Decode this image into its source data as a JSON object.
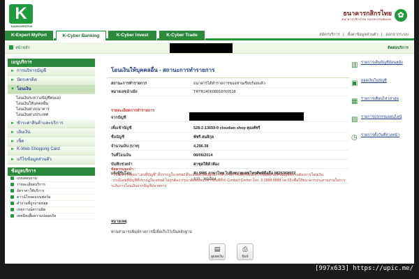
{
  "header": {
    "logo_letter": "K",
    "logo_text": "KASIKORNTHAI",
    "bank_name_th": "ธนาคารกสิกรไทย",
    "bank_name_en": "ธนาคารกสิกรไทย KASIKORNBANK"
  },
  "nav": {
    "tabs": [
      {
        "label": "K-Expert MyPort"
      },
      {
        "label": "K-Cyber Banking"
      },
      {
        "label": "K-Cyber Invest"
      },
      {
        "label": "K-Cyber Trade"
      }
    ],
    "top_links": [
      "สมัครบริการ",
      "ตั้งค่าข้อมูลส่วนตัว",
      "ออกจากระบบ"
    ]
  },
  "crumb": {
    "home": "หน้าหลัก",
    "contact": "ติดต่อบริการ"
  },
  "sidebar": {
    "menu_title": "เมนูบริการ",
    "items": [
      {
        "label": "การบริหารบัญชี"
      },
      {
        "label": "บัตรเครดิต"
      },
      {
        "label": "โอนเงิน"
      }
    ],
    "sub_items": [
      "โอนเงินระหว่างบัญชีตนเอง",
      "โอนเงินให้บุคคลอื่น",
      "โอนเงินต่างธนาคาร",
      "โอนเงินต่างประเทศ"
    ],
    "items2": [
      {
        "label": "ชำระค่าสินค้าและบริการ"
      },
      {
        "label": "เติมเงิน"
      },
      {
        "label": "เช็ค"
      },
      {
        "label": "K-Web Shopping Card"
      },
      {
        "label": "แก้ไขข้อมูลส่วนตัว"
      }
    ],
    "info_title": "ข้อมูลบริการ",
    "info_items": [
      "แบบสอบถาม",
      "รายละเอียดบริการ",
      "อัตราค่าใช้บริการ",
      "ดาวน์โหลดแบบฟอร์ม",
      "คำถามที่ถูกถามบ่อย",
      "เหตุการณ์ความผิด",
      "เทคนิคเพื่อความปลอดภัย"
    ]
  },
  "main": {
    "title": "โอนเงินให้บุคคลอื่น - สถานะการทำรายการ",
    "status_label": "สถานะการทำรายการ",
    "status_value": "ธนาคารได้ทำรายการของท่านเรียบร้อยแล้ว",
    "ref_label": "หมายเลขอ้างอิง",
    "ref_value": "TRTR140608918760518",
    "section_title": "รายละเอียดการทำรายการ",
    "from_label": "จากบัญชี",
    "to_label": "เพื่อเข้าบัญชี",
    "to_value": "528-2-13659-9 cloudian shop คุณพัชรี",
    "name_label": "ชื่อบัญชี",
    "name_value": "พัชรี สนลิกุล",
    "amount_label": "จำนวนเงิน (บาท)",
    "amount_value": "4,296.38",
    "date_label": "วันที่โอนเงิน",
    "date_value": "08/06/2014",
    "memo_label": "บันทึกช่วยจำ",
    "memo_value": "ค่าชุดให้ค้าห้อง",
    "notify_label": "แจ้งผู้รับโอน",
    "notify_value": "ส่ง SMS ภาษาไทย ไปยังหมายเลขโทรศัพท์มือถือ 0826368972",
    "notify_value2": "จาก : คุณอ้อง",
    "notes_title": "ข้อควรแนะนำ :",
    "note1": "- โปรดตรวจสอบ \"เลขที่บัญชี\" ที่ปรากฏใน email ที่ระบบส่งไปยังผู้รับการทำรายการเพื่อให้แน่ใจว่าเป็นหมายเลขบัญชีที่ท่านต้องการโอนเงิน",
    "note2": "- กรณีเลขที่บัญชีที่ปรากฏใน email ไม่ถูกต้อง กรุณาติดต่อธนาคารทันทีที่ K-Contact Center โทร. 0 2888 8888 กด 03 เพื่อให้ธนาคารประสานงานในการระงับการโอนเงินจากบัญชีปลายทาง",
    "remark_title": "หมายเหตุ",
    "remark_text": "ท่านสามารถพิมพ์รายการนี้เพื่อเก็บไว้เป็นหลักฐาน",
    "btn_save": "ดูยอดเงิน",
    "btn_print": "พิมพ์"
  },
  "right": {
    "items": [
      "รายการเดินบัญชีย้อนหลัง",
      "ยอดเงินในบัญชี",
      "รายการเตือนไหว่ล่าสุด",
      "รายการธุรกรรมออนไลน์",
      "รายการตั้งวันที่ล่วงหน้า"
    ]
  },
  "watermark": "[997x633] https://upic.me/"
}
